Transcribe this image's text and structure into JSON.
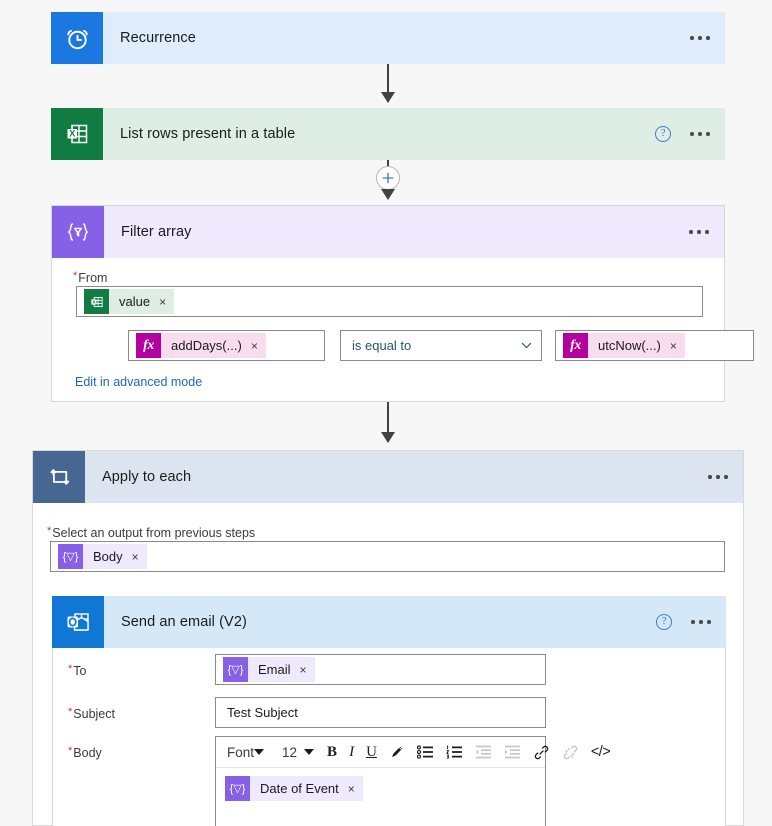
{
  "flow": {
    "steps": [
      {
        "id": "recurrence",
        "title": "Recurrence",
        "icon": "alarm-clock-icon",
        "tile_color": "#1b78e0",
        "header_color": "#dfecfb",
        "has_help": false
      },
      {
        "id": "list-rows",
        "title": "List rows present in a table",
        "icon": "excel-icon",
        "tile_color": "#107c41",
        "header_color": "#dfeee4",
        "has_help": true
      },
      {
        "id": "filter-array",
        "title": "Filter array",
        "icon": "filter-braces-icon",
        "tile_color": "#8661e8",
        "header_color": "#eee9fd",
        "has_help": false
      },
      {
        "id": "apply-to-each",
        "title": "Apply to each",
        "icon": "loop-icon",
        "tile_color": "#456791",
        "header_color": "#dce4ef",
        "has_help": false
      },
      {
        "id": "send-email",
        "title": "Send an email (V2)",
        "icon": "outlook-icon",
        "tile_color": "#0f78d4",
        "header_color": "#d5e8f8",
        "has_help": true
      }
    ]
  },
  "filter_array": {
    "from_label": "From",
    "from_token": {
      "text": "value",
      "icon": "excel-icon",
      "remove": "×"
    },
    "left_token": {
      "text": "addDays(...)",
      "icon": "fx-icon",
      "remove": "×"
    },
    "operator": "is equal to",
    "right_token": {
      "text": "utcNow(...)",
      "icon": "fx-icon",
      "remove": "×"
    },
    "advanced_link": "Edit in advanced mode"
  },
  "apply_to_each": {
    "select_label": "Select an output from previous steps",
    "token": {
      "text": "Body",
      "icon": "braces-icon",
      "remove": "×"
    }
  },
  "send_email": {
    "to_label": "To",
    "to_token": {
      "text": "Email",
      "icon": "braces-icon",
      "remove": "×"
    },
    "subject_label": "Subject",
    "subject_value": "Test Subject",
    "body_label": "Body",
    "body_token": {
      "text": "Date of Event",
      "icon": "braces-icon",
      "remove": "×"
    },
    "toolbar": {
      "font_name": "Font",
      "font_size": "12",
      "bold": "B",
      "italic": "I",
      "underline": "U",
      "highlight": "pen-icon",
      "bulleted_list": "bulleted-list-icon",
      "numbered_list": "numbered-list-icon",
      "indent_decrease": "indent-decrease-icon",
      "indent_increase": "indent-increase-icon",
      "link": "link-icon",
      "unlink": "unlink-icon",
      "code_view": "</>"
    }
  },
  "common": {
    "required_mark": "*",
    "help_glyph": "?",
    "plus_glyph": "+",
    "menu": "more-options"
  }
}
